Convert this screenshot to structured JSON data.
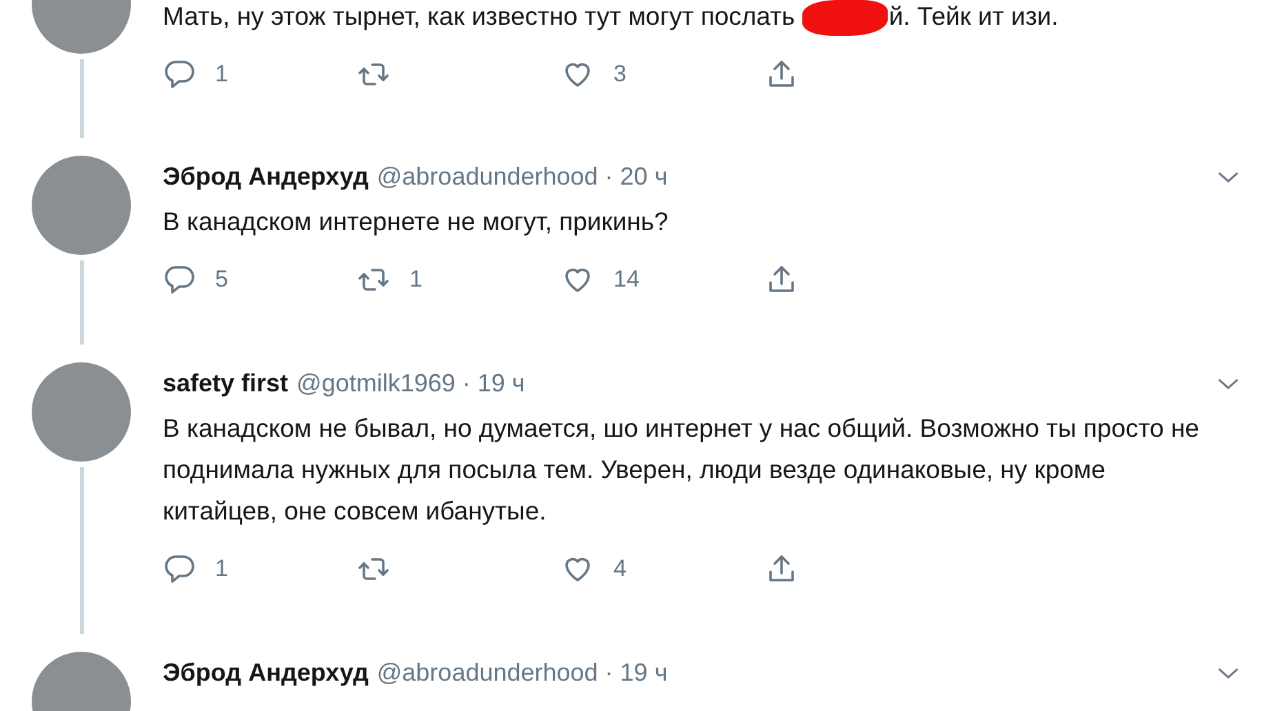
{
  "tweets": [
    {
      "text_before": "Мать, ну этож тырнет, как известно тут могут послать ",
      "redacted": true,
      "text_after": "й. Тейк ит изи.",
      "actions": {
        "replies": "1",
        "likes": "3"
      }
    },
    {
      "name": "Эброд Андерхуд",
      "handle": "@abroadunderhood",
      "time": "· 20 ч",
      "text_before": "В канадском интернете не могут, прикинь?",
      "actions": {
        "replies": "5",
        "retweets": "1",
        "likes": "14"
      }
    },
    {
      "name": "safety first",
      "handle": "@gotmilk1969",
      "time": "· 19 ч",
      "text_before": "В канадском не бывал, но думается, шо интернет у нас общий. Возможно ты просто не поднимала нужных для посыла тем. Уверен, люди везде одинаковые, ну кроме китайцев, оне совсем ибанутые.",
      "actions": {
        "replies": "1",
        "likes": "4"
      }
    },
    {
      "name": "Эброд Андерхуд",
      "handle": "@abroadunderhood",
      "time": "· 19 ч"
    }
  ]
}
